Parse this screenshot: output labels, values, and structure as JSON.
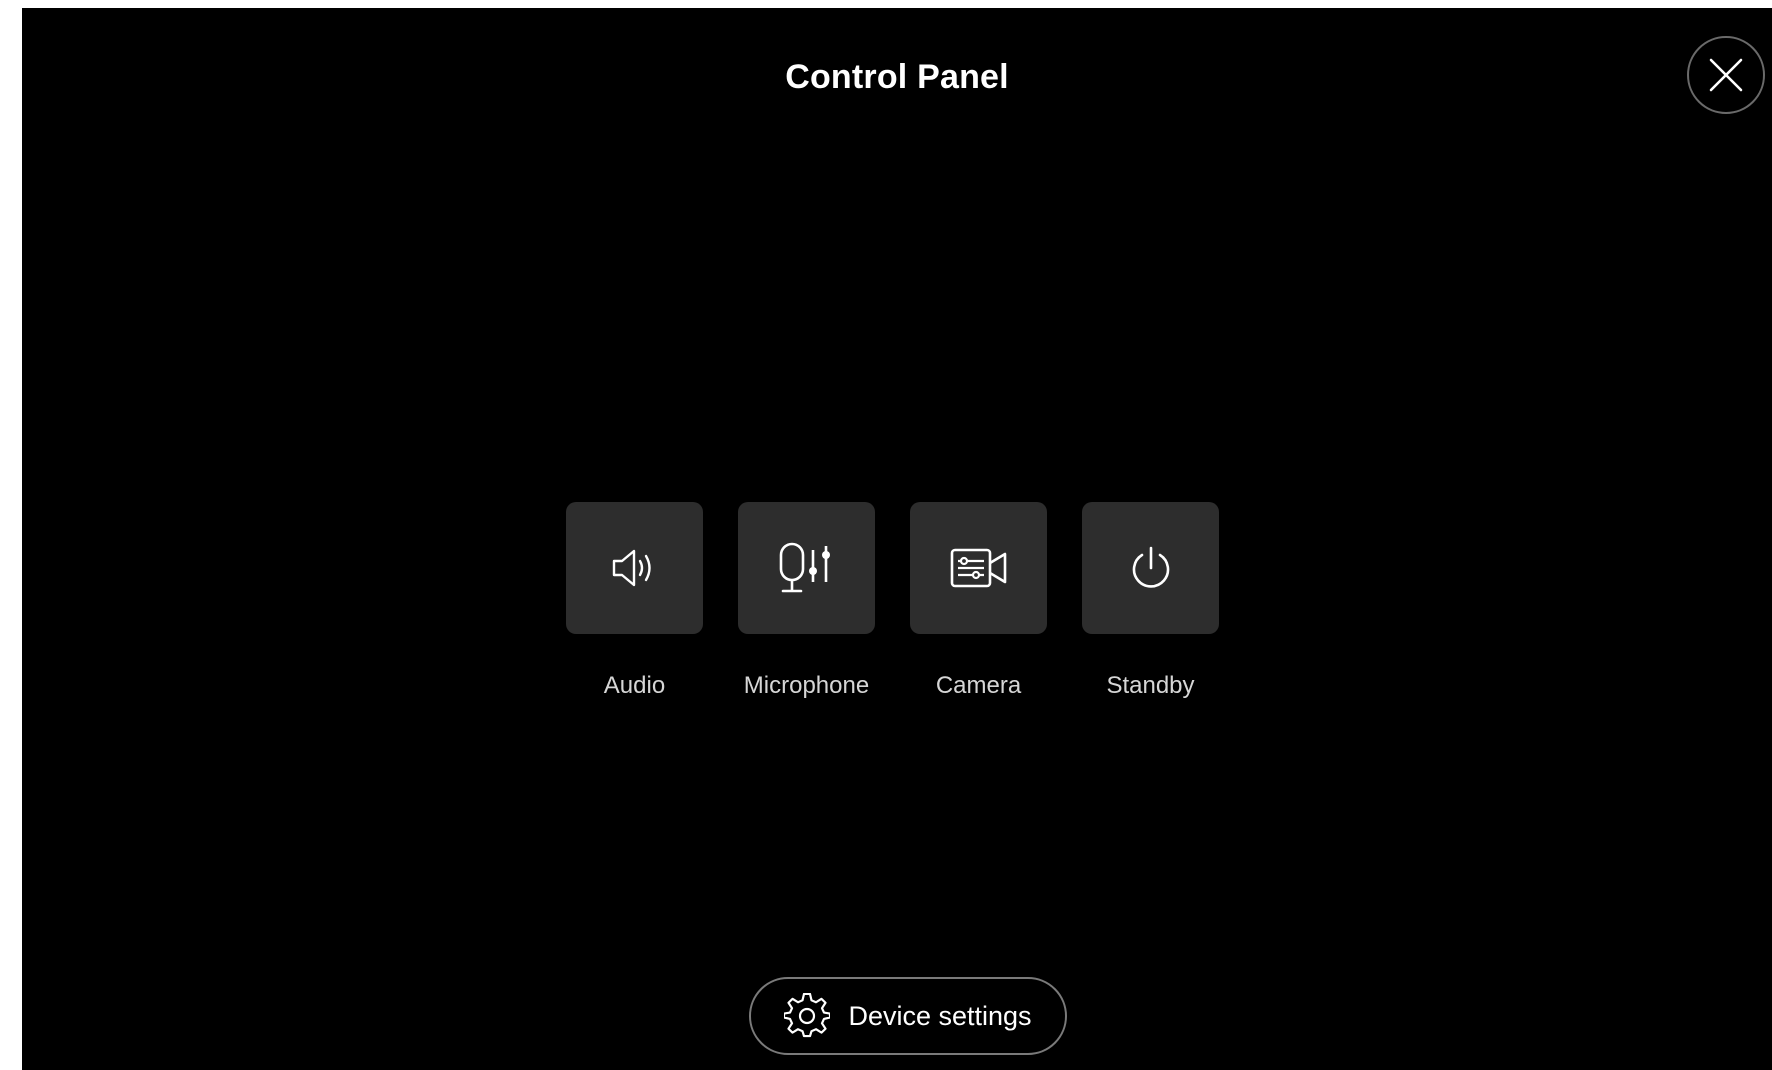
{
  "header": {
    "title": "Control Panel",
    "close_icon": "close-icon"
  },
  "controls": [
    {
      "label": "Audio",
      "icon": "speaker-icon"
    },
    {
      "label": "Microphone",
      "icon": "microphone-settings-icon"
    },
    {
      "label": "Camera",
      "icon": "camera-settings-icon"
    },
    {
      "label": "Standby",
      "icon": "power-icon"
    }
  ],
  "footer": {
    "settings_label": "Device settings",
    "settings_icon": "gear-icon"
  },
  "colors": {
    "background": "#000000",
    "tile": "#2d2d2d",
    "text": "#ffffff",
    "label_text": "#d6d6d6",
    "outline": "#7a7a7a"
  }
}
